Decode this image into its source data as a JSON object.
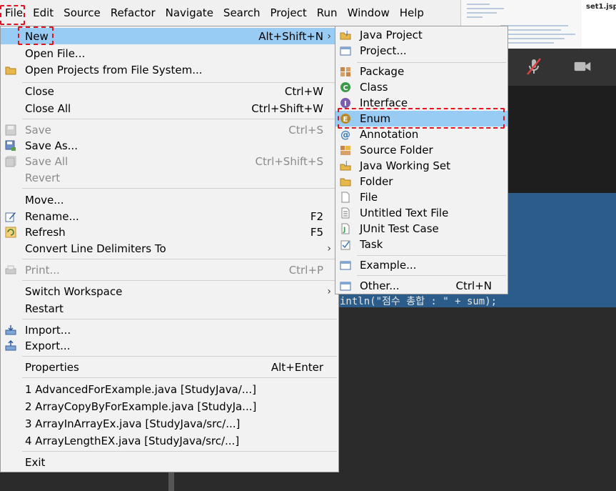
{
  "menubar": [
    "File",
    "Edit",
    "Source",
    "Refactor",
    "Navigate",
    "Search",
    "Project",
    "Run",
    "Window",
    "Help"
  ],
  "file_menu": {
    "new": {
      "label": "New",
      "accel": "Alt+Shift+N"
    },
    "open_file": {
      "label": "Open File..."
    },
    "open_projects": {
      "label": "Open Projects from File System..."
    },
    "close": {
      "label": "Close",
      "accel": "Ctrl+W"
    },
    "close_all": {
      "label": "Close All",
      "accel": "Ctrl+Shift+W"
    },
    "save": {
      "label": "Save",
      "accel": "Ctrl+S"
    },
    "save_as": {
      "label": "Save As..."
    },
    "save_all": {
      "label": "Save All",
      "accel": "Ctrl+Shift+S"
    },
    "revert": {
      "label": "Revert"
    },
    "move": {
      "label": "Move..."
    },
    "rename": {
      "label": "Rename...",
      "accel": "F2"
    },
    "refresh": {
      "label": "Refresh",
      "accel": "F5"
    },
    "convert": {
      "label": "Convert Line Delimiters To"
    },
    "print": {
      "label": "Print...",
      "accel": "Ctrl+P"
    },
    "switch_workspace": {
      "label": "Switch Workspace"
    },
    "restart": {
      "label": "Restart"
    },
    "import": {
      "label": "Import..."
    },
    "export": {
      "label": "Export..."
    },
    "properties": {
      "label": "Properties",
      "accel": "Alt+Enter"
    },
    "recent": [
      "1 AdvancedForExample.java  [StudyJava/...]",
      "2 ArrayCopyByForExample.java  [StudyJa...]",
      "3 ArrayInArrayEx.java  [StudyJava/src/...]",
      "4 ArrayLengthEX.java  [StudyJava/src/...]"
    ],
    "exit": {
      "label": "Exit"
    }
  },
  "new_submenu": {
    "java_project": "Java Project",
    "project": "Project...",
    "package": "Package",
    "class": "Class",
    "interface": "Interface",
    "enum": "Enum",
    "annotation": "Annotation",
    "source_folder": "Source Folder",
    "java_working_set": "Java Working Set",
    "folder": "Folder",
    "file": "File",
    "untitled_text_file": "Untitled Text File",
    "junit_test_case": "JUnit Test Case",
    "task": "Task",
    "example": "Example...",
    "other": {
      "label": "Other...",
      "accel": "Ctrl+N"
    }
  },
  "background": {
    "code_line": "intln(\"점수 총합 : \" + sum);",
    "thumb_title": "set1.jsp"
  },
  "colors": {
    "highlight": "#99ccf5",
    "annotation_dash": "#e0141e"
  }
}
